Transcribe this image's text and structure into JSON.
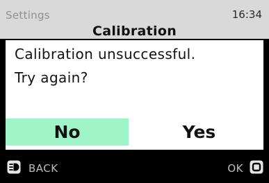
{
  "header": {
    "breadcrumb": "Settings",
    "time": "16:34",
    "title": "Calibration"
  },
  "dialog": {
    "message_line1": "Calibration unsuccessful.",
    "message_line2": "Try again?",
    "options": [
      {
        "label": "No",
        "selected": true
      },
      {
        "label": "Yes",
        "selected": false
      }
    ]
  },
  "softkeys": {
    "left": {
      "label": "BACK",
      "icon": "back-key-icon"
    },
    "right": {
      "label": "OK",
      "icon": "ok-key-icon"
    }
  },
  "colors": {
    "header_background": "#d9d9d9",
    "selection_highlight": "#9ff5c8",
    "softkey_bar": "#000000"
  }
}
